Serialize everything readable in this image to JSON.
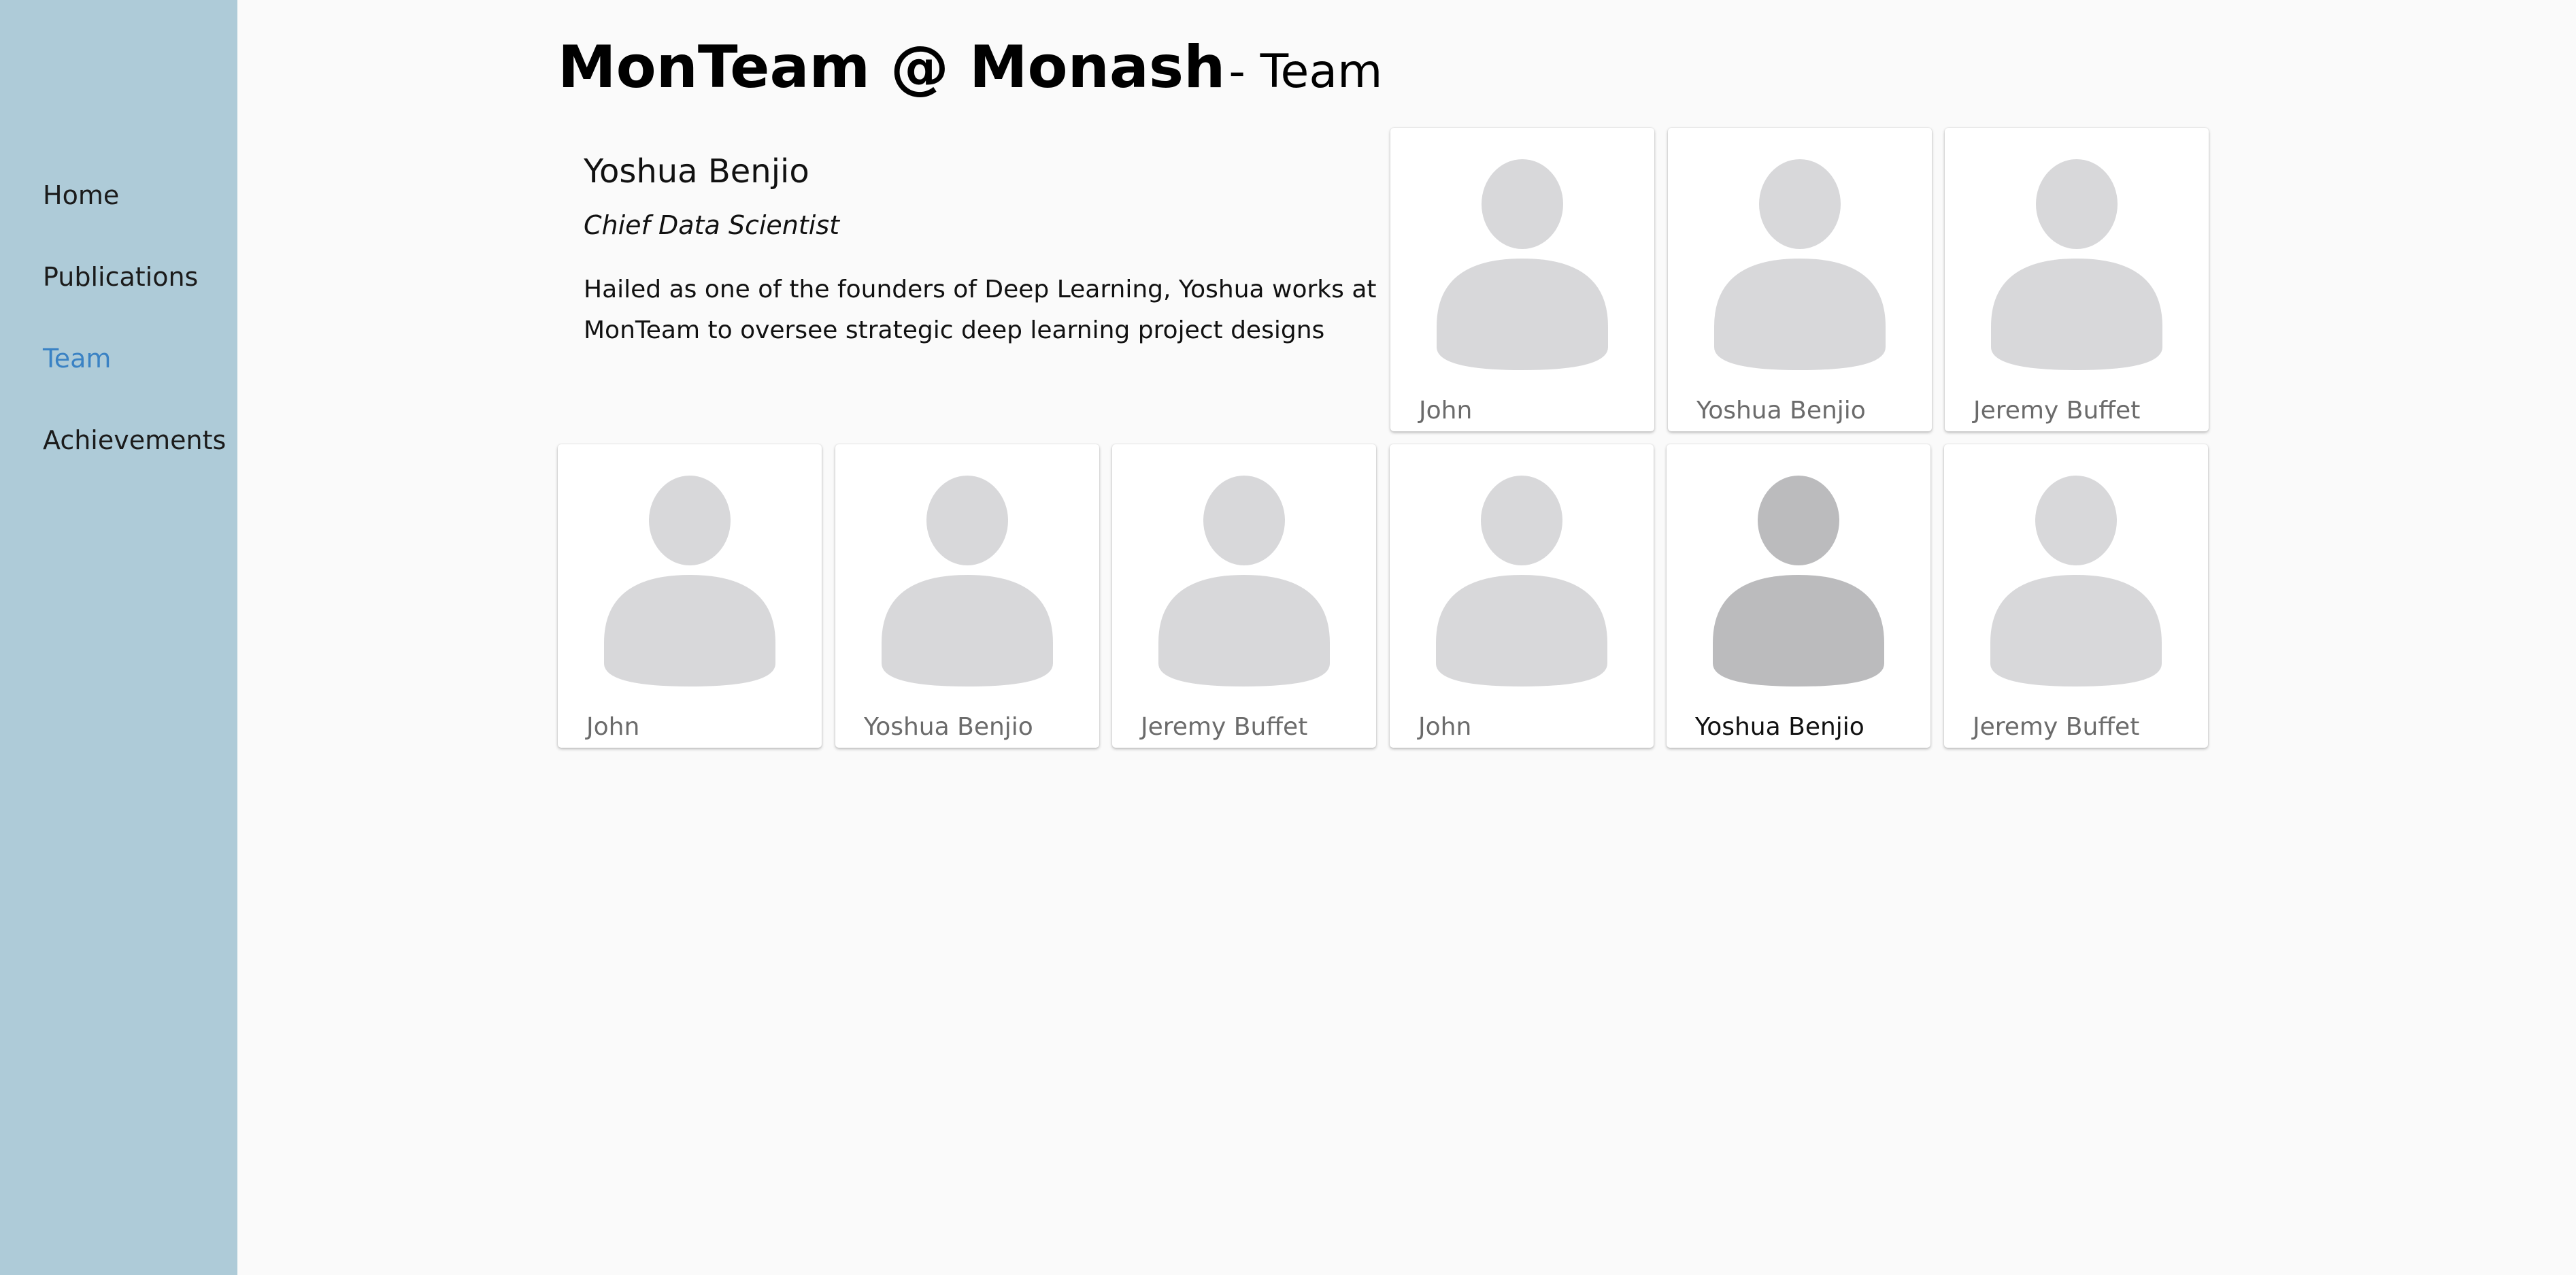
{
  "nav": {
    "items": [
      {
        "label": "Home",
        "active": false
      },
      {
        "label": "Publications",
        "active": false
      },
      {
        "label": "Team",
        "active": true
      },
      {
        "label": "Achievements",
        "active": false
      }
    ]
  },
  "header": {
    "title": "MonTeam @ Monash",
    "subtitle": "- Team"
  },
  "selected_member": {
    "name": "Yoshua Benjio",
    "role": "Chief Data Scientist",
    "bio": "Hailed as one of the founders of Deep Learning, Yoshua works at MonTeam to oversee strategic deep learning project designs"
  },
  "cards": [
    {
      "name": "John",
      "icon": "person-avatar-icon"
    },
    {
      "name": "Yoshua Benjio",
      "icon": "person-avatar-icon"
    },
    {
      "name": "Jeremy Buffet",
      "icon": "person-avatar-icon"
    },
    {
      "name": "John",
      "icon": "person-avatar-icon"
    },
    {
      "name": "Yoshua Benjio",
      "icon": "person-avatar-icon"
    },
    {
      "name": "Jeremy Buffet",
      "icon": "person-avatar-icon"
    },
    {
      "name": "John",
      "icon": "person-avatar-icon"
    },
    {
      "name": "Yoshua Benjio",
      "icon": "person-avatar-icon",
      "selected": true
    },
    {
      "name": "Jeremy Buffet",
      "icon": "person-avatar-icon"
    }
  ],
  "colors": {
    "sidebar_bg": "#aecbd8",
    "nav_active": "#3a82c4",
    "avatar_default": "#d8d8da",
    "avatar_selected": "#bbbbbd",
    "page_bg": "#fafafa"
  }
}
